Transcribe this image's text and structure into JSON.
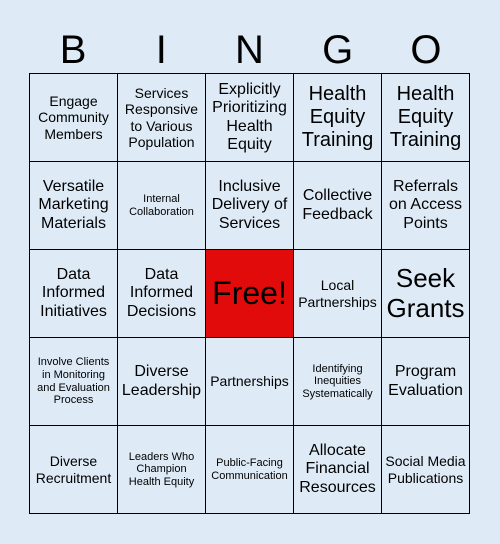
{
  "header": {
    "letters": [
      "B",
      "I",
      "N",
      "G",
      "O"
    ]
  },
  "board": {
    "free_color": "#e20b0b",
    "background_color": "#deebf7",
    "cells": [
      {
        "text": "Engage Community Members",
        "size": "sm"
      },
      {
        "text": "Services Responsive to Various Population",
        "size": "sm"
      },
      {
        "text": "Explicitly Prioritizing Health Equity",
        "size": "md"
      },
      {
        "text": "Health Equity Training",
        "size": "lg"
      },
      {
        "text": "Health Equity Training",
        "size": "lg"
      },
      {
        "text": "Versatile Marketing Materials",
        "size": "md"
      },
      {
        "text": "Internal Collaboration",
        "size": "xs"
      },
      {
        "text": "Inclusive Delivery of Services",
        "size": "md"
      },
      {
        "text": "Collective Feedback",
        "size": "md"
      },
      {
        "text": "Referrals on Access Points",
        "size": "md"
      },
      {
        "text": "Data Informed Initiatives",
        "size": "md"
      },
      {
        "text": "Data Informed Decisions",
        "size": "md"
      },
      {
        "text": "Free!",
        "size": "free",
        "free": true
      },
      {
        "text": "Local Partnerships",
        "size": "sm"
      },
      {
        "text": "Seek Grants",
        "size": "xl"
      },
      {
        "text": "Involve Clients in Monitoring and Evaluation Process",
        "size": "xs"
      },
      {
        "text": "Diverse Leadership",
        "size": "md"
      },
      {
        "text": "Partnerships",
        "size": "sm"
      },
      {
        "text": "Identifying Inequities Systematically",
        "size": "xs"
      },
      {
        "text": "Program Evaluation",
        "size": "md"
      },
      {
        "text": "Diverse Recruitment",
        "size": "sm"
      },
      {
        "text": "Leaders Who Champion Health Equity",
        "size": "xs"
      },
      {
        "text": "Public-Facing Communication",
        "size": "xs"
      },
      {
        "text": "Allocate Financial Resources",
        "size": "md"
      },
      {
        "text": "Social Media Publications",
        "size": "sm"
      }
    ]
  }
}
